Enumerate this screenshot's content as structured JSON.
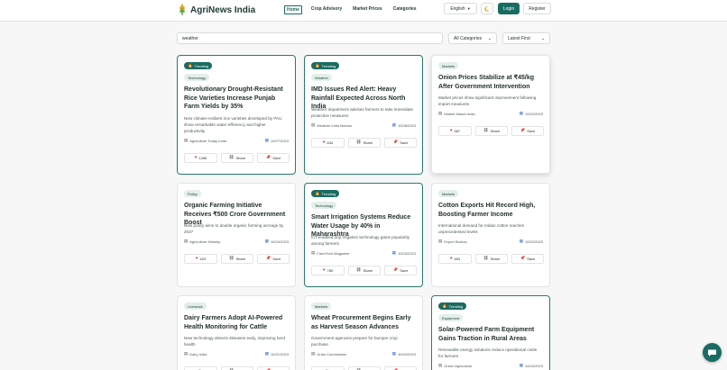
{
  "header": {
    "logo_text": "AgriNews India",
    "nav": [
      "Home",
      "Crop Advisory",
      "Market Prices",
      "Categories"
    ],
    "language": "English",
    "login": "Login",
    "register": "Register"
  },
  "filters": {
    "search_value": "weather",
    "category": "All Categories",
    "sort": "Latest First"
  },
  "actions": {
    "share": "Share",
    "save": "Save"
  },
  "trending_label": "Trending",
  "cards": [
    {
      "trending": true,
      "category": "Technology",
      "title": "Revolutionary Drought-Resistant Rice Varieties Increase Punjab Farm Yields by 35%",
      "description": "New climate-resilient rice varieties developed by PAU show remarkable water efficiency and higher productivity",
      "source": "Agriculture Today India",
      "date": "10/27/2023",
      "likes": "1289"
    },
    {
      "trending": true,
      "category": "Weather",
      "title": "IMD Issues Red Alert: Heavy Rainfall Expected Across North India",
      "description": "Weather department advises farmers to take immediate protective measures",
      "source": "Weather India Bureau",
      "date": "10/28/2023",
      "likes": "634"
    },
    {
      "trending": false,
      "category": "Markets",
      "title": "Onion Prices Stabilize at ₹45/kg After Government Intervention",
      "description": "Market prices show significant improvement following import measures",
      "source": "Market Watch India",
      "date": "10/22/2023",
      "likes": "567"
    },
    {
      "trending": false,
      "category": "Policy",
      "title": "Organic Farming Initiative Receives ₹500 Crore Government Boost",
      "description": "New policy aims to double organic farming acreage by 2027",
      "source": "Agriculture Ministry",
      "date": "10/24/2023",
      "likes": "423"
    },
    {
      "trending": true,
      "category": "Technology",
      "title": "Smart Irrigation Systems Reduce Water Usage by 40% in Maharashtra",
      "description": "IoT-enabled drip irrigation technology gains popularity among farmers",
      "source": "FarmTech Magazine",
      "date": "10/23/2023",
      "likes": "789"
    },
    {
      "trending": false,
      "category": "Markets",
      "title": "Cotton Exports Hit Record High, Boosting Farmer Income",
      "description": "International demand for Indian cotton reaches unprecedented levels",
      "source": "Export Bureau",
      "date": "10/22/2023",
      "likes": "654"
    },
    {
      "trending": false,
      "category": "Livestock",
      "title": "Dairy Farmers Adopt AI-Powered Health Monitoring for Cattle",
      "description": "New technology detects diseases early, improving herd health",
      "source": "Dairy India",
      "date": "10/21/2023",
      "likes": ""
    },
    {
      "trending": false,
      "category": "Markets",
      "title": "Wheat Procurement Begins Early as Harvest Season Advances",
      "description": "Government agencies prepare for bumper crop purchase",
      "source": "Grain Commission",
      "date": "10/20/2023",
      "likes": ""
    },
    {
      "trending": true,
      "category": "Equipment",
      "title": "Solar-Powered Farm Equipment Gains Traction in Rural Areas",
      "description": "Renewable energy solutions reduce operational costs for farmers",
      "source": "Green Agriculture",
      "date": "10/19/2023",
      "likes": ""
    }
  ]
}
